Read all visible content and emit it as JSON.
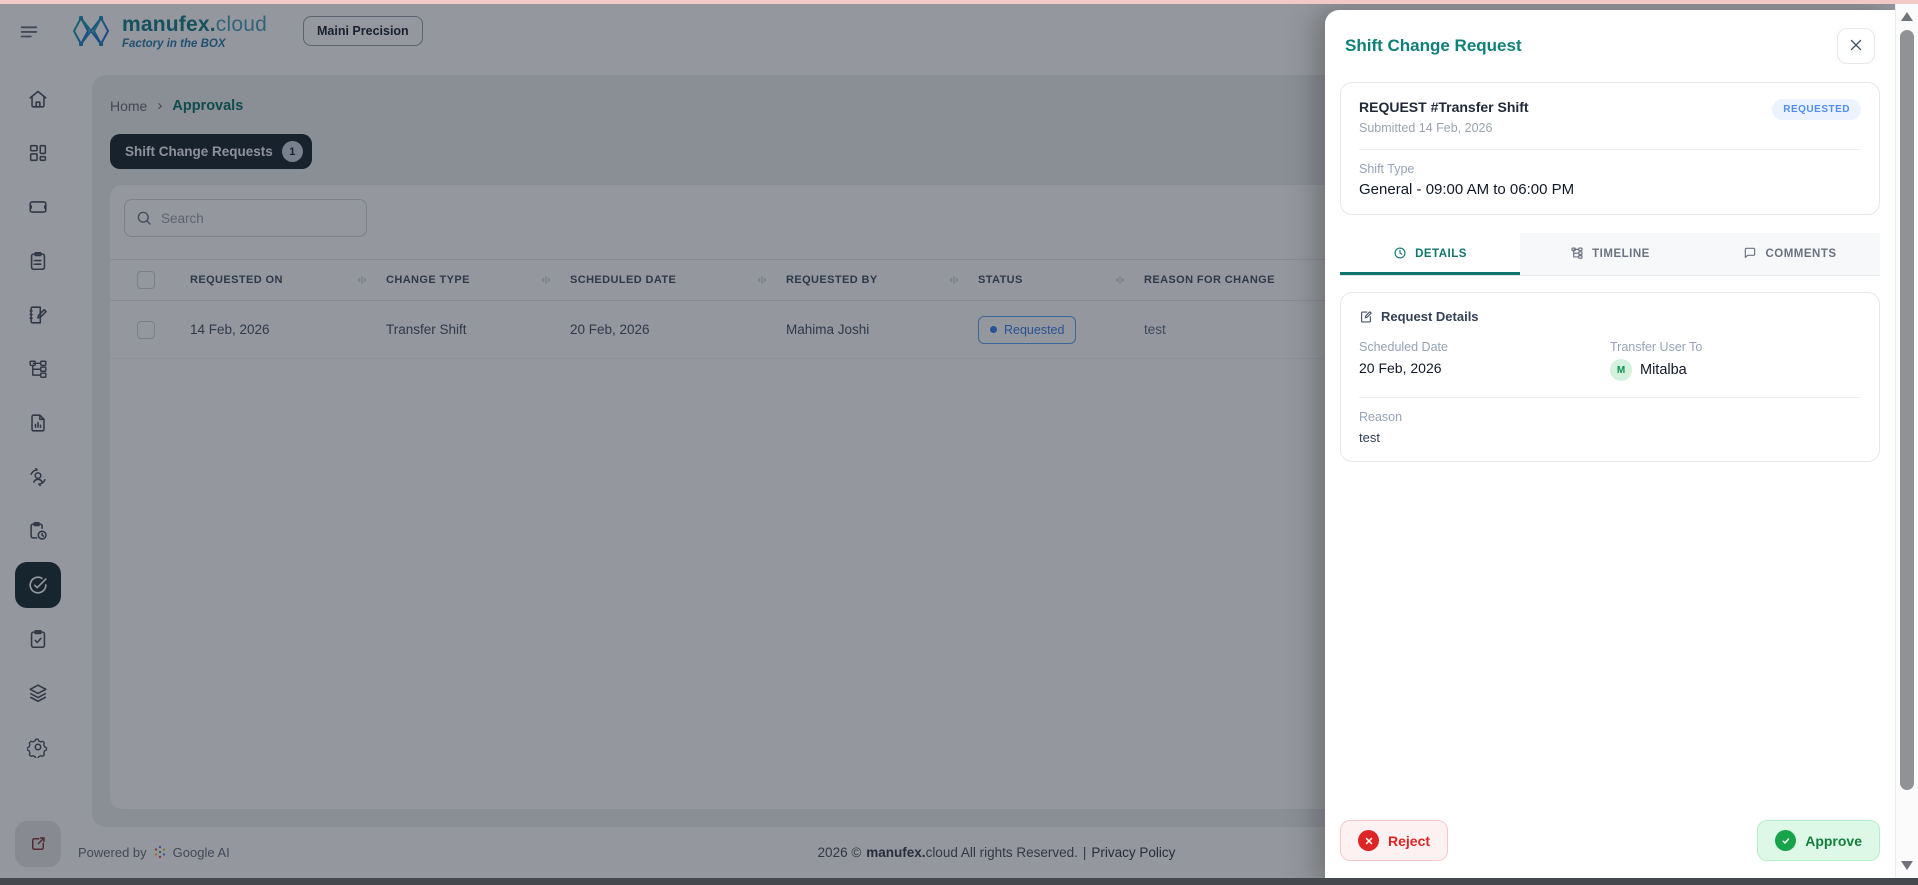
{
  "header": {
    "brand": {
      "primary": "manufex.",
      "secondary": "cloud",
      "tagline": "Factory in the BOX"
    },
    "org_badge": "Maini Precision"
  },
  "breadcrumb": {
    "home": "Home",
    "current": "Approvals"
  },
  "main": {
    "tab_pill": {
      "label": "Shift Change Requests",
      "count": "1"
    },
    "search": {
      "placeholder": "Search"
    },
    "table": {
      "columns": [
        "REQUESTED ON",
        "CHANGE TYPE",
        "SCHEDULED DATE",
        "REQUESTED BY",
        "STATUS",
        "REASON FOR CHANGE"
      ],
      "rows": [
        {
          "requested_on": "14 Feb, 2026",
          "change_type": "Transfer Shift",
          "scheduled_date": "20 Feb, 2026",
          "requested_by": "Mahima Joshi",
          "status": "Requested",
          "reason": "test"
        }
      ]
    }
  },
  "footer": {
    "powered_by": "Powered by",
    "google_ai": "Google AI",
    "year_symbol": "2026 ©",
    "brand_bold": "manufex.",
    "rights": "cloud All rights Reserved.",
    "separator": "|",
    "privacy": "Privacy Policy"
  },
  "panel": {
    "title": "Shift Change Request",
    "request_card": {
      "title": "REQUEST #Transfer Shift",
      "submitted": "Submitted 14 Feb, 2026",
      "status_badge": "REQUESTED",
      "shift_type_label": "Shift Type",
      "shift_type_value": "General - 09:00 AM to 06:00 PM"
    },
    "tabs": [
      {
        "label": "DETAILS",
        "icon": "clock-icon",
        "active": true
      },
      {
        "label": "TIMELINE",
        "icon": "hierarchy-icon",
        "active": false
      },
      {
        "label": "COMMENTS",
        "icon": "chat-icon",
        "active": false
      }
    ],
    "details_card": {
      "title": "Request Details",
      "scheduled_date_label": "Scheduled Date",
      "scheduled_date_value": "20 Feb, 2026",
      "transfer_user_label": "Transfer User To",
      "transfer_user_initial": "M",
      "transfer_user_name": "Mitalba",
      "reason_label": "Reason",
      "reason_value": "test"
    },
    "actions": {
      "reject": "Reject",
      "approve": "Approve"
    }
  },
  "sidebar": {
    "icons": [
      "home-icon",
      "dashboard-icon",
      "ticket-icon",
      "clipboard-list-icon",
      "notebook-pen-icon",
      "hierarchy-icon",
      "report-icon",
      "user-sync-icon",
      "clipboard-clock-icon",
      "approvals-check-icon",
      "clipboard-check-icon",
      "layers-icon",
      "settings-icon"
    ],
    "active_icon": "approvals-check-icon",
    "bottom_icon": "external-link-icon"
  },
  "colors": {
    "accent_teal": "#0f766e",
    "dark_pill": "#1c2b33",
    "status_blue": "#3b82f6",
    "approve_green": "#16a34a",
    "reject_red": "#dc2626",
    "avatar_green_bg": "#d3f1dd",
    "top_line_pink": "#f3c9c5"
  }
}
